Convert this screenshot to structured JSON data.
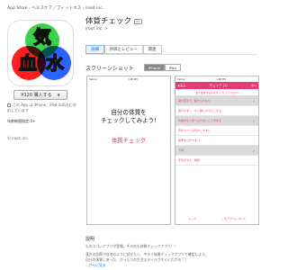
{
  "breadcrumb": "App Store › ヘルスケア／フィットネス › iroot inc.",
  "icon": {
    "chars": [
      "気",
      "血",
      "水"
    ],
    "colors": [
      "#37d24a",
      "#ff1e1e",
      "#2a63ff"
    ]
  },
  "buy": {
    "label": "¥120 購入する",
    "arrow": "▼"
  },
  "compat_text": "この App は iPhone、iPad の両方に対応しています",
  "rating": "年齢制限指定:4+",
  "copyright": "© iroot, inc.",
  "app": {
    "title": "体質チェック",
    "age_badge": "4+",
    "developer": "iroot inc. >"
  },
  "tabs": [
    "詳細",
    "評価とレビュー",
    "関連"
  ],
  "screenshots": {
    "title": "スクリーンショット",
    "device_toggle": [
      "iPhone",
      "iPad"
    ],
    "shot1": {
      "carrier": "Carrier",
      "time": "1:08 PM",
      "line1": "自分の体質を",
      "line2": "チェックしてみよう!",
      "button": "体質チェック"
    },
    "shot2": {
      "carrier": "Carrier",
      "time": "1:08 PM",
      "back": "◀ 戻る",
      "nav_title": "チェック (1)",
      "next": "次へ",
      "hint": "当てはまるものをタップしてください",
      "rows": [
        {
          "label": "朝が苦手で、起きられない",
          "checked": true
        },
        {
          "label": "疲れやすく、すぐ横になりたくなる",
          "checked": false
        },
        {
          "label": "食欲がなく食べられないことがある",
          "checked": true
        },
        {
          "label": "声が小さく息切れしやすい",
          "checked": false
        },
        {
          "label": "風邪をひきやすい",
          "checked": false
        },
        {
          "label": "下痢",
          "checked": true
        },
        {
          "label": "手足が冷え、頻尿",
          "checked": false
        }
      ],
      "check_mark": "✓",
      "footer": [
        "トップ",
        "このアプリについて"
      ]
    }
  },
  "description": {
    "heading": "説明",
    "line1": "ものスゴいアプリが登場。その名も体質チェックアプリ！！",
    "line2": "漢方の診察が自宅のように試せたら、今すぐ体質チェックアプリで確認しよう。",
    "line3": "自分の体質にあった、ぴったりの生活スタイルがすぐにわかる！！",
    "more": "...さらに見る"
  }
}
